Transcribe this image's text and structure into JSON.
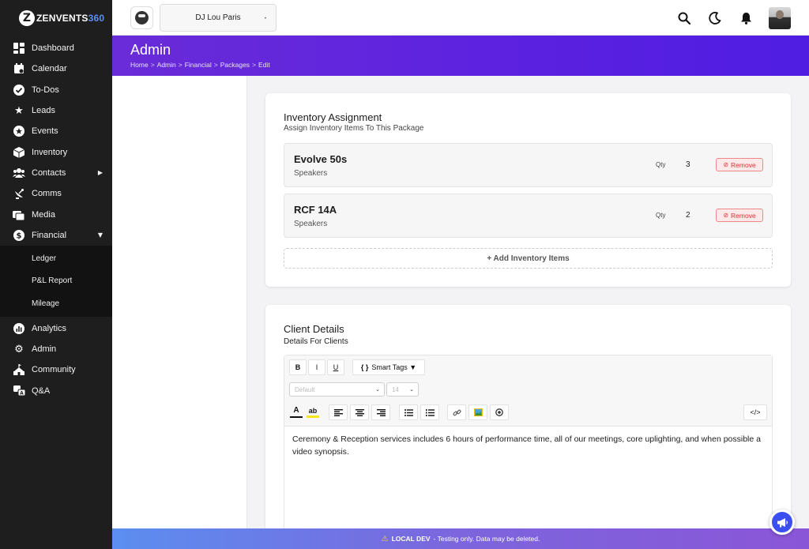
{
  "app": {
    "logo_letter": "Z",
    "logo_text": "ZENVENTS",
    "logo_num": "360"
  },
  "sidebar": {
    "items": [
      {
        "label": "Dashboard",
        "icon": "dashboard-icon"
      },
      {
        "label": "Calendar",
        "icon": "calendar-icon"
      },
      {
        "label": "To-Dos",
        "icon": "check-circle-icon"
      },
      {
        "label": "Leads",
        "icon": "stars-icon"
      },
      {
        "label": "Events",
        "icon": "star-circle-icon"
      },
      {
        "label": "Inventory",
        "icon": "box-icon"
      },
      {
        "label": "Contacts",
        "icon": "users-icon"
      },
      {
        "label": "Comms",
        "icon": "satellite-dish-icon"
      },
      {
        "label": "Media",
        "icon": "photos-icon"
      },
      {
        "label": "Financial",
        "icon": "dollar-circle-icon"
      },
      {
        "label": "Analytics",
        "icon": "chart-icon"
      },
      {
        "label": "Admin",
        "icon": "gear-icon"
      },
      {
        "label": "Community",
        "icon": "community-icon"
      },
      {
        "label": "Q&A",
        "icon": "language-icon"
      }
    ],
    "financial_sub": [
      "Ledger",
      "P&L Report",
      "Mileage"
    ],
    "contacts_caret": "▶",
    "financial_caret": "▼"
  },
  "topbar": {
    "brand_name": "DJ Lou Paris",
    "brand_dot": "•"
  },
  "header": {
    "title": "Admin",
    "breadcrumb": [
      "Home",
      "Admin",
      "Financial",
      "Packages",
      "Edit"
    ],
    "sep": ">"
  },
  "inventory": {
    "title": "Inventory Assignment",
    "subtitle": "Assign Inventory Items To This Package",
    "qty_label": "Qty",
    "remove_label": "Remove",
    "remove_icon": "⊘",
    "items": [
      {
        "name": "Evolve 50s",
        "category": "Speakers",
        "qty": "3"
      },
      {
        "name": "RCF 14A",
        "category": "Speakers",
        "qty": "2"
      }
    ],
    "add_label": "+ Add Inventory Items"
  },
  "client": {
    "title": "Client Details",
    "subtitle": "Details For Clients",
    "toolbar": {
      "bold": "B",
      "italic": "I",
      "underline": "U",
      "smart_tags_brace": "{ }",
      "smart_tags": "Smart Tags ▼",
      "font_select": "Default",
      "size_select": "14",
      "font_color": "A",
      "highlight": "ab",
      "code": "</>"
    },
    "body_text": "Ceremony & Reception services includes 6 hours of performance time, all of our meetings, core uplighting, and when possible a video synopsis."
  },
  "devbar": {
    "icon": "⚠",
    "label": "LOCAL DEV",
    "message": "- Testing only. Data may be deleted."
  },
  "colors": {
    "sidebar_bg": "#1e1e1e",
    "header_start": "#6a2cd8",
    "header_end": "#4f1de2",
    "accent": "#3b4ff0",
    "remove_red": "#dd3333"
  }
}
